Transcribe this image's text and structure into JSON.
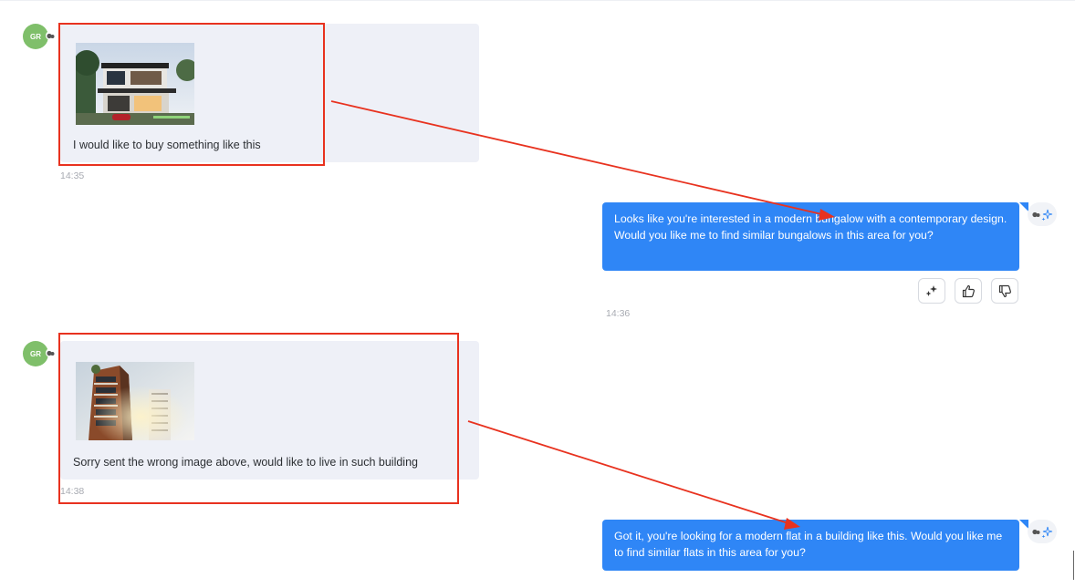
{
  "messages": [
    {
      "sender": "user",
      "avatar": "GR",
      "text": "I would like to buy something like this",
      "time": "14:35",
      "image": "modern-bungalow-photo"
    },
    {
      "sender": "bot",
      "text": "Looks like you're interested in a modern bungalow with a contemporary design. Would you like me to find similar bungalows in this area for you?",
      "time": "14:36",
      "actions": [
        "magic-icon",
        "thumbs-up-icon",
        "thumbs-down-icon"
      ]
    },
    {
      "sender": "user",
      "avatar": "GR",
      "text": "Sorry sent the wrong image above, would like to live in such building",
      "time": "14:38",
      "image": "apartment-building-photo"
    },
    {
      "sender": "bot",
      "text": "Got it, you're looking for a modern flat in a building like this. Would you like me to find similar flats in this area for you?"
    }
  ],
  "colors": {
    "bot_bubble": "#2f86f6",
    "user_bubble": "#eef0f7",
    "avatar": "#7fbf6a",
    "annotation": "#e8321f"
  }
}
